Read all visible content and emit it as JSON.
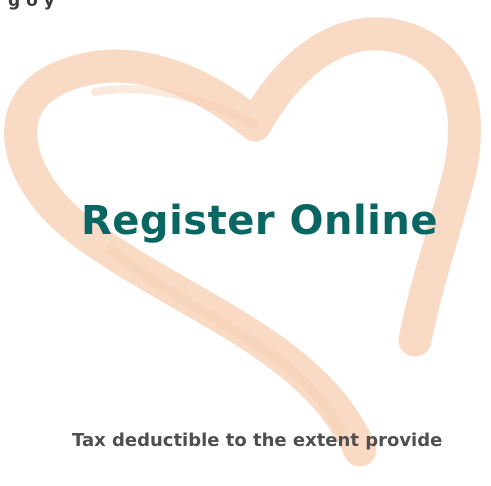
{
  "top_text": "g   o   y",
  "title": "Register Online",
  "footer_note": "Tax deductible to the extent provide",
  "colors": {
    "heart": "#f8d8c2",
    "title": "#0a6662",
    "text": "#4f4f4f"
  }
}
